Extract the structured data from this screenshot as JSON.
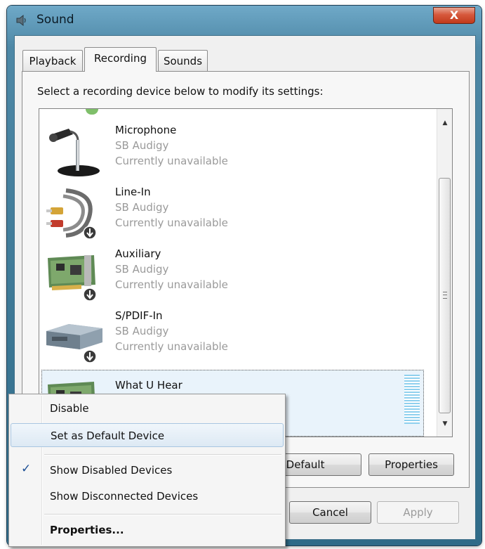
{
  "window": {
    "title": "Sound",
    "close_glyph": "X"
  },
  "tabs": [
    {
      "label": "Playback"
    },
    {
      "label": "Recording"
    },
    {
      "label": "Sounds"
    }
  ],
  "active_tab": "Recording",
  "instruction": "Select a recording device below to modify its settings:",
  "devices": [
    {
      "name": "Microphone",
      "driver": "SB Audigy",
      "status": "Currently unavailable",
      "icon": "microphone-icon"
    },
    {
      "name": "Line-In",
      "driver": "SB Audigy",
      "status": "Currently unavailable",
      "icon": "line-in-cable-icon"
    },
    {
      "name": "Auxiliary",
      "driver": "SB Audigy",
      "status": "Currently unavailable",
      "icon": "sound-card-icon"
    },
    {
      "name": "S/PDIF-In",
      "driver": "SB Audigy",
      "status": "Currently unavailable",
      "icon": "spdif-box-icon"
    },
    {
      "name": "What U Hear",
      "icon": "sound-card-icon",
      "selected": true
    }
  ],
  "buttons": {
    "set_default": "t Default",
    "properties": "Properties",
    "cancel": "Cancel",
    "apply": "Apply"
  },
  "context_menu": {
    "items": [
      {
        "label": "Disable"
      },
      {
        "label": "Set as Default Device",
        "highlighted": true
      },
      {
        "label": "Show Disabled Devices",
        "checked": true
      },
      {
        "label": "Show Disconnected Devices"
      },
      {
        "label": "Properties...",
        "bold": true
      }
    ]
  },
  "colors": {
    "accent": "#1c4f95",
    "selection": "#e9f3fb",
    "close": "#c23a1b"
  }
}
